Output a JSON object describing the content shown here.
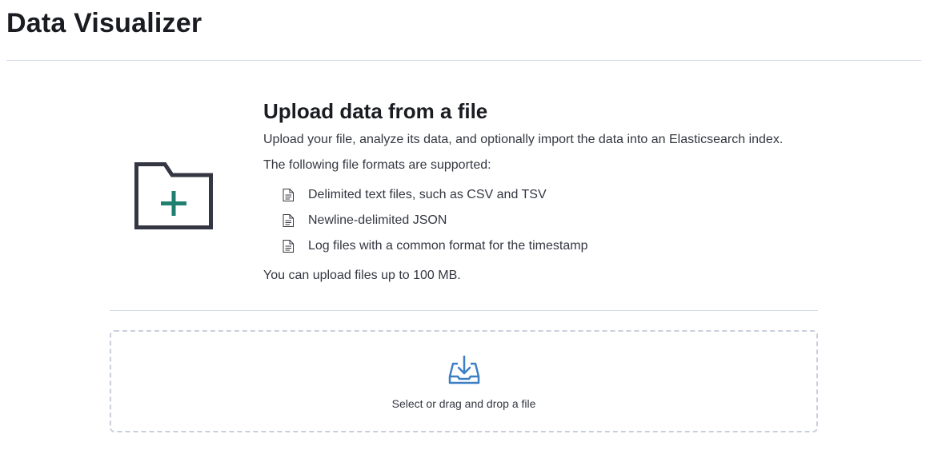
{
  "page": {
    "title": "Data Visualizer"
  },
  "upload": {
    "title": "Upload data from a file",
    "description": "Upload your file, analyze its data, and optionally import the data into an Elasticsearch index.",
    "formats_intro": "The following file formats are supported:",
    "formats": [
      "Delimited text files, such as CSV and TSV",
      "Newline-delimited JSON",
      "Log files with a common format for the timestamp"
    ],
    "size_limit": "You can upload files up to 100 MB."
  },
  "dropzone": {
    "label": "Select or drag and drop a file"
  },
  "icons": {
    "folder": "folder-add-icon",
    "document": "document-icon",
    "upload": "import-icon"
  },
  "colors": {
    "title": "#1a1c21",
    "text": "#343741",
    "folder_outline": "#343741",
    "folder_plus": "#207f6f",
    "upload_icon": "#3c7fc4",
    "divider": "#d3dae6",
    "dropzone_border": "#c9d0dc"
  }
}
